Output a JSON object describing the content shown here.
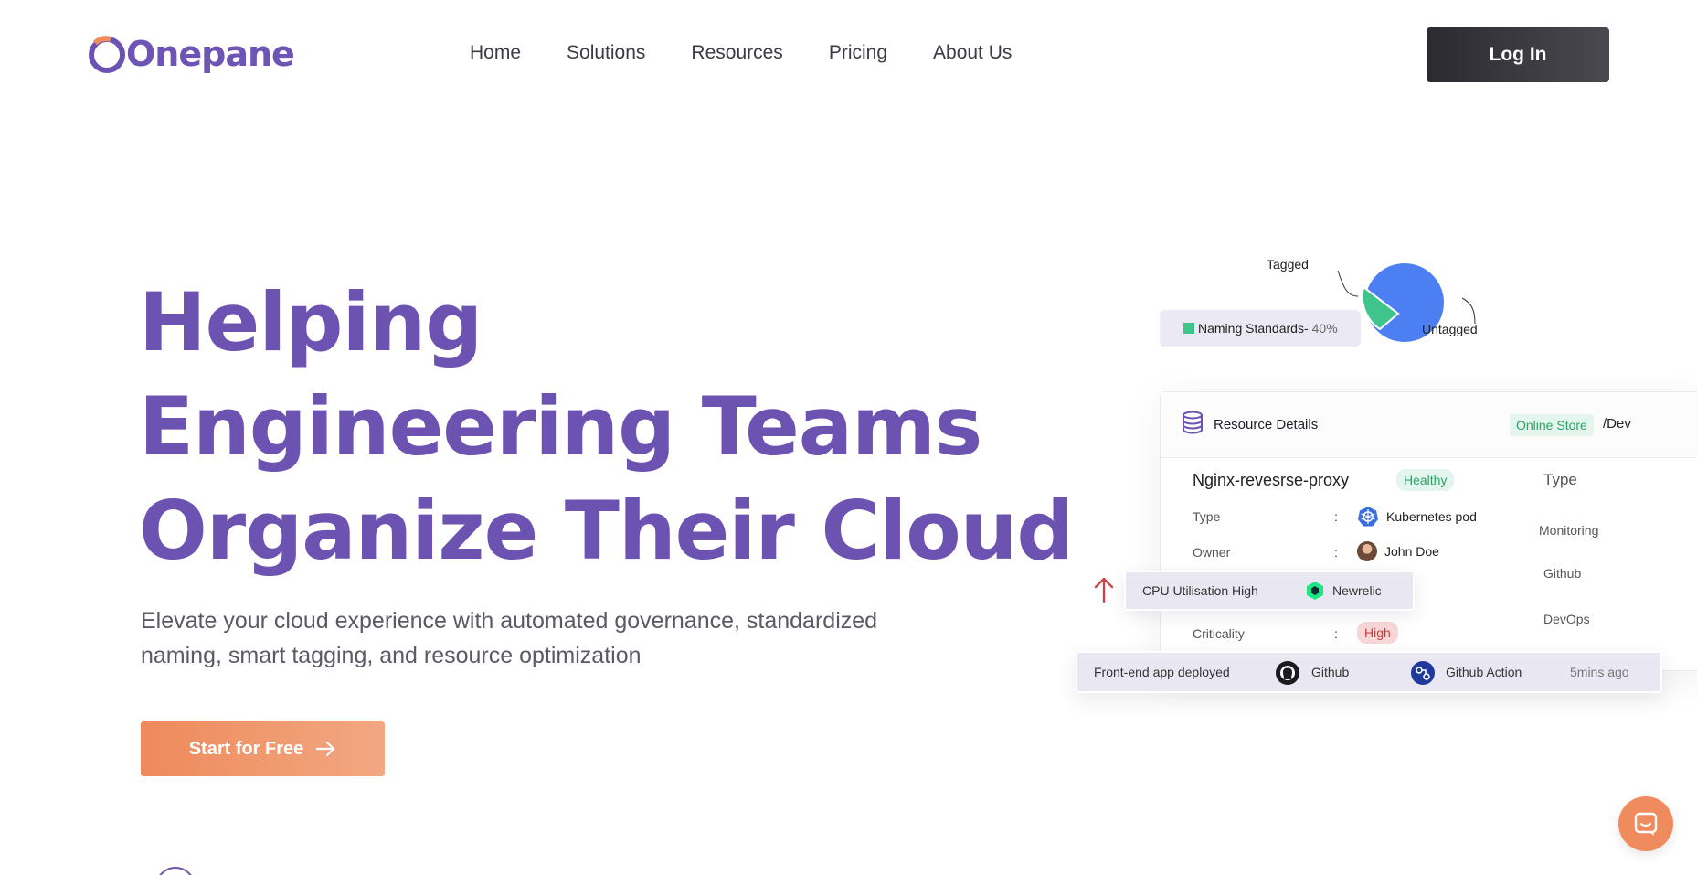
{
  "brand": {
    "name": "Onepane",
    "primary_color": "#6c52b1",
    "accent_color": "#ef8b5c"
  },
  "nav": {
    "items": [
      {
        "label": "Home"
      },
      {
        "label": "Solutions"
      },
      {
        "label": "Resources"
      },
      {
        "label": "Pricing"
      },
      {
        "label": "About Us"
      }
    ],
    "login_label": "Log In"
  },
  "hero": {
    "title_lines": [
      "Helping",
      "Engineering Teams",
      "Organize Their Cloud"
    ],
    "subtitle": "Elevate your cloud experience with automated governance, standardized naming, smart tagging, and resource optimization",
    "cta_label": "Start for Free"
  },
  "visual": {
    "pie": {
      "tagged_label": "Tagged",
      "untagged_label": "Untagged",
      "naming_label": "Naming Standards-",
      "naming_pct": "40%"
    },
    "card": {
      "title": "Resource Details",
      "tag": "Online Store",
      "env": "/Dev",
      "resource_name": "Nginx-revesrse-proxy",
      "status": "Healthy",
      "side_header": "Type",
      "rows": [
        {
          "key": "Type",
          "value": "Kubernetes pod"
        },
        {
          "key": "Owner",
          "value": "John Doe"
        },
        {
          "key": "Criticality",
          "value": "High"
        }
      ],
      "side_items": [
        "Monitoring",
        "Github",
        "DevOps"
      ]
    },
    "alert": {
      "text": "CPU Utilisation High",
      "source": "Newrelic"
    },
    "deploy": {
      "text": "Front-end app deployed",
      "source1": "Github",
      "source2": "Github Action",
      "time": "5mins ago"
    }
  }
}
